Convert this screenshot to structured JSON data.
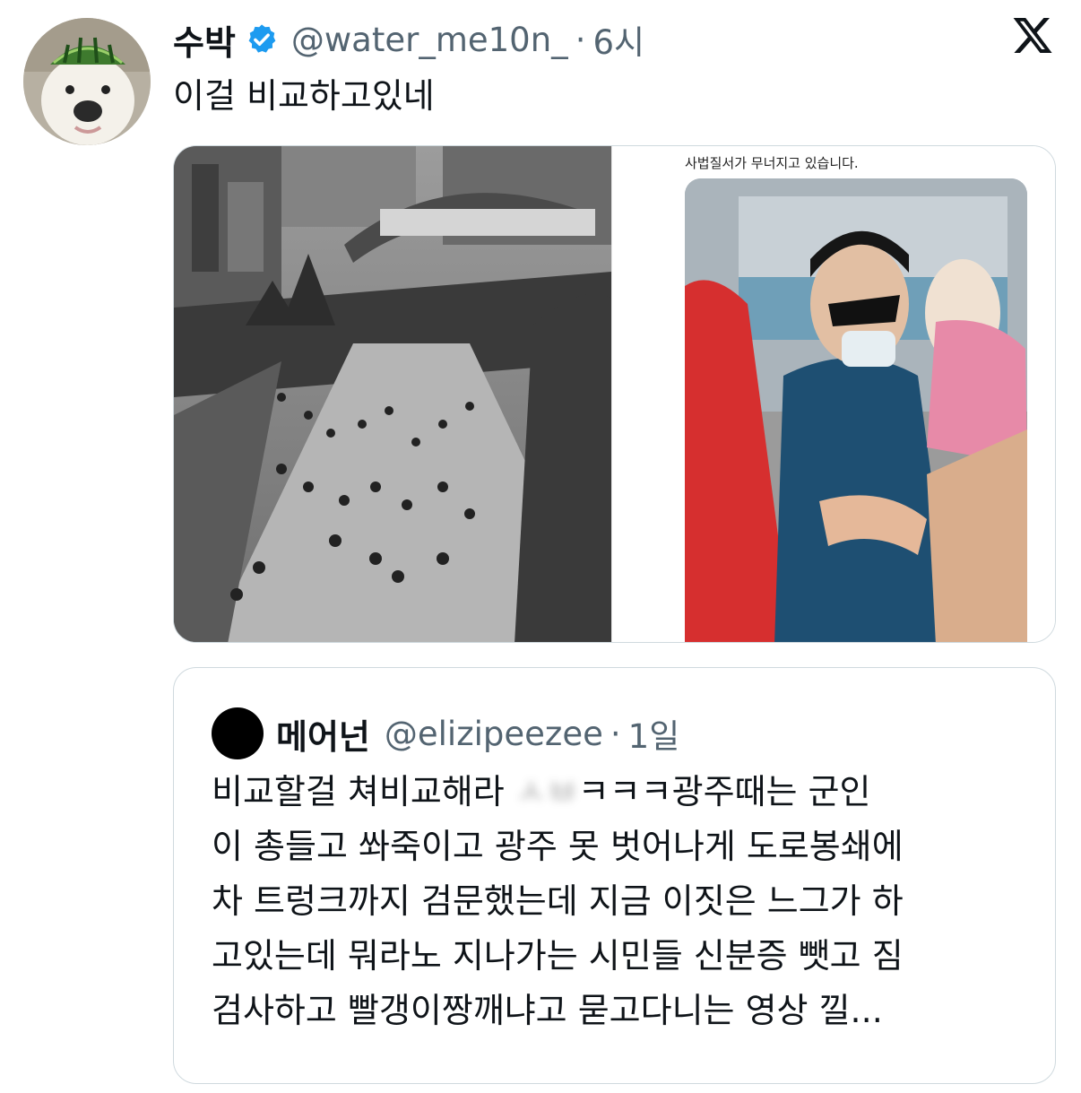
{
  "tweet": {
    "author_name": "수박",
    "handle": "@water_me10n_",
    "separator": "·",
    "time": "6시",
    "text": "이걸 비교하고있네"
  },
  "media": {
    "right_caption": "사법질서가 무너지고 있습니다."
  },
  "quote": {
    "author_name": "메어넌",
    "handle": "@elizipeezee",
    "separator": "·",
    "time": "1일",
    "lines": [
      {
        "before": "비교할걸 쳐비교해라 ",
        "blurred": "ㅅㅂ",
        "after": "ㅋㅋㅋ광주때는 군인"
      },
      {
        "text": "이 총들고 쏴죽이고 광주 못 벗어나게 도로봉쇄에"
      },
      {
        "text": "차 트렁크까지 검문했는데 지금 이짓은 느그가 하"
      },
      {
        "text": "고있는데 뭐라노 지나가는 시민들 신분증 뺏고 짐"
      },
      {
        "text": "검사하고 빨갱이짱깨냐고 묻고다니는 영상 낄..."
      }
    ]
  },
  "icons": {
    "avatar": "dog-with-watermelon-hat-avatar",
    "verified": "verified-badge-icon",
    "brand": "x-logo-icon"
  },
  "colors": {
    "verified_blue": "#1d9bf0",
    "secondary_text": "#536471",
    "border": "#cfd9de"
  }
}
